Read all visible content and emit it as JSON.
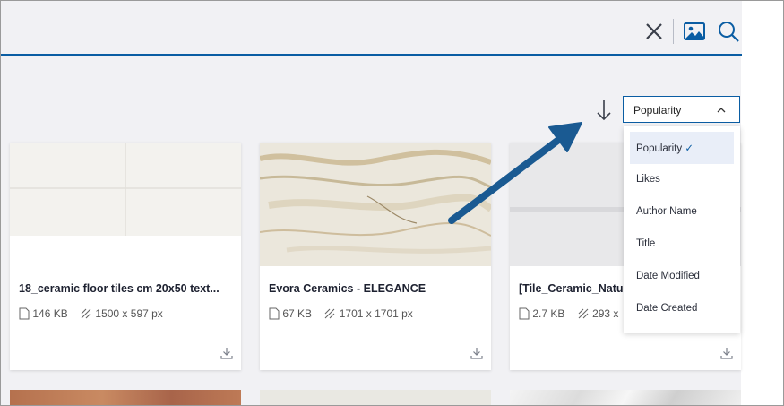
{
  "toolbar": {
    "close_icon": "close-icon",
    "image_search_icon": "image-icon",
    "search_icon": "search-icon"
  },
  "sort": {
    "selected": "Popularity",
    "options": [
      {
        "label": "Popularity",
        "selected": true
      },
      {
        "label": "Likes"
      },
      {
        "label": "Author Name"
      },
      {
        "label": "Title"
      },
      {
        "label": "Date Modified"
      },
      {
        "label": "Date Created"
      }
    ]
  },
  "cards": [
    {
      "title": "18_ceramic floor tiles cm 20x50 text...",
      "size": "146 KB",
      "dimensions": "1500 x 597 px"
    },
    {
      "title": "Evora Ceramics - ELEGANCE",
      "size": "67 KB",
      "dimensions": "1701 x 1701 px"
    },
    {
      "title": "[Tile_Ceramic_Natu",
      "size": "2.7 KB",
      "dimensions": "293 x"
    }
  ],
  "colors": {
    "accent": "#0a5da3",
    "arrow": "#0f5a9a",
    "background": "#f1f1f4"
  }
}
